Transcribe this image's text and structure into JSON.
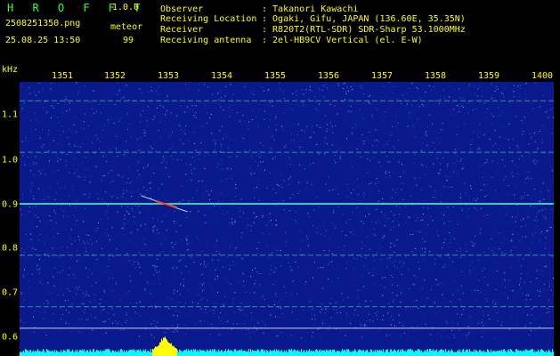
{
  "header": {
    "app_title": "H R O F F T",
    "version": "1.0.0",
    "filename": "2508251350.png",
    "datetime": "25.08.25 13:50",
    "meteor_label": "meteor",
    "meteor_count": "99",
    "info": [
      {
        "label": "Observer",
        "value": ": Takanori Kawachi"
      },
      {
        "label": "Receiving Location",
        "value": ": Ogaki, Gifu, JAPAN (136.60E, 35.35N)"
      },
      {
        "label": "Receiver",
        "value": ": R820T2(RTL-SDR) SDR-Sharp 53.1000MHz"
      },
      {
        "label": "Receiving antenna",
        "value": ": 2el-HB9CV Vertical (el. E-W)"
      }
    ]
  },
  "axis": {
    "y_unit": "kHz",
    "x_ticks": [
      "1351",
      "1352",
      "1353",
      "1354",
      "1355",
      "1356",
      "1357",
      "1358",
      "1359",
      "1400"
    ],
    "y_ticks": [
      "1.1",
      "1.0",
      "0.9",
      "0.8",
      "0.7",
      "0.6"
    ]
  },
  "colors": {
    "background": "#0a1a8c",
    "header_text": "#ffff00",
    "title_text": "#33ff33",
    "signal_line": "#3fe0c0",
    "meteor_echo": "#ff4020",
    "level_bar": "#00ffff",
    "level_peak": "#ffff00"
  },
  "chart_data": {
    "type": "heatmap",
    "xlabel": "",
    "ylabel": "kHz",
    "x_range": [
      "13:50",
      "14:00"
    ],
    "ylim": [
      0.58,
      1.19
    ],
    "grid": false,
    "carrier_lines_khz": [
      1.15,
      1.03,
      0.91,
      0.79,
      0.67
    ],
    "reference_line_khz": 0.62,
    "meteor_echoes": [
      {
        "time_min": 2.9,
        "freq_khz": 0.91
      }
    ]
  }
}
